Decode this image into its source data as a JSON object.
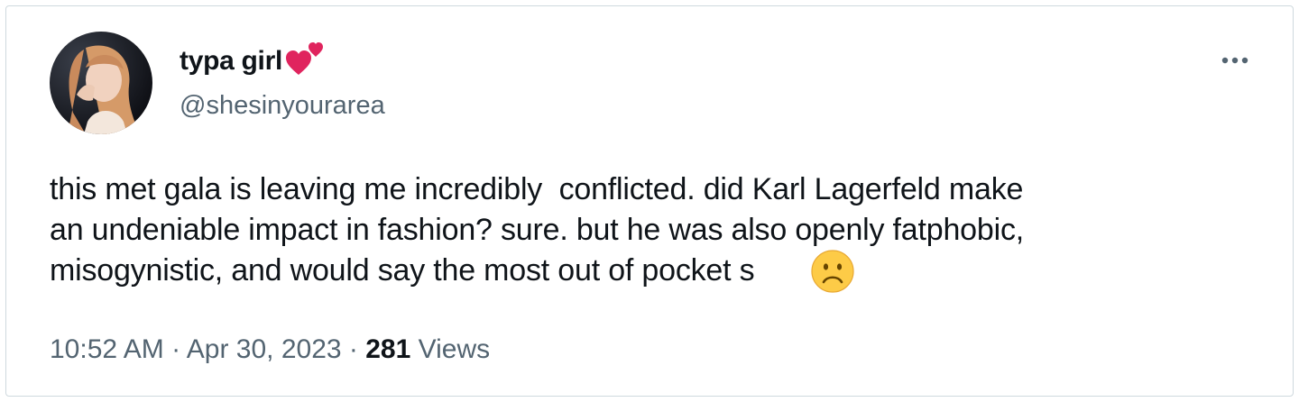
{
  "tweet": {
    "author": {
      "display_name": "typa girl",
      "name_emoji_icon": "two-hearts-icon",
      "handle": "@shesinyourarea"
    },
    "more_icon": "more-horizontal-icon",
    "text_lines": [
      "this met gala is leaving me incredibly  conflicted. did Karl Lagerfeld make",
      "an undeniable impact in fashion? sure. but he was also openly fatphobic,",
      "misogynistic, and would say the most out of pocket s"
    ],
    "text_emoji_icon": "slightly-frowning-face-icon",
    "time": "10:52 AM",
    "separator": " · ",
    "date": "Apr 30, 2023",
    "views_count": "281",
    "views_label": "Views"
  },
  "colors": {
    "text_primary": "#0f1419",
    "text_secondary": "#536471",
    "border": "#cfd9de",
    "heart": "#e0245e"
  }
}
